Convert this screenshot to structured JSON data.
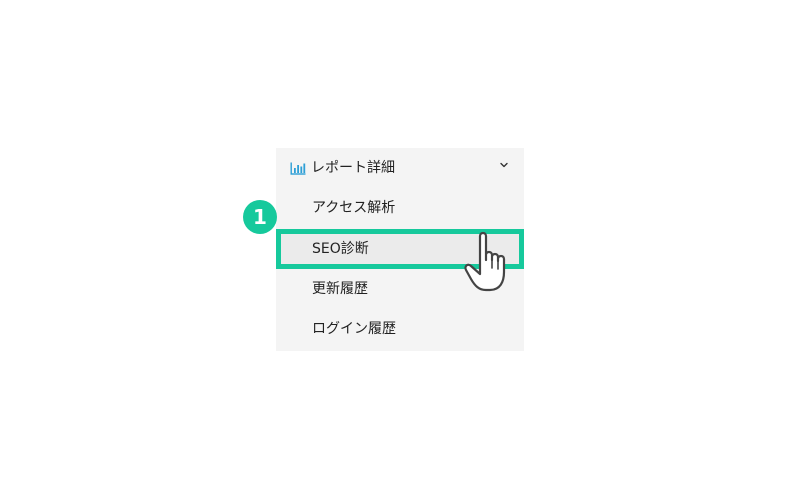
{
  "menu": {
    "header": {
      "label": "レポート詳細",
      "icon": "bar-chart-icon",
      "expand_icon": "chevron-down-icon"
    },
    "items": [
      {
        "label": "アクセス解析",
        "selected": false
      },
      {
        "label": "SEO診断",
        "selected": true
      },
      {
        "label": "更新履歴",
        "selected": false
      },
      {
        "label": "ログイン履歴",
        "selected": false
      }
    ]
  },
  "annotation": {
    "step_number": "1",
    "accent_color": "#16c99c",
    "pointer_icon": "hand-pointer-icon"
  }
}
